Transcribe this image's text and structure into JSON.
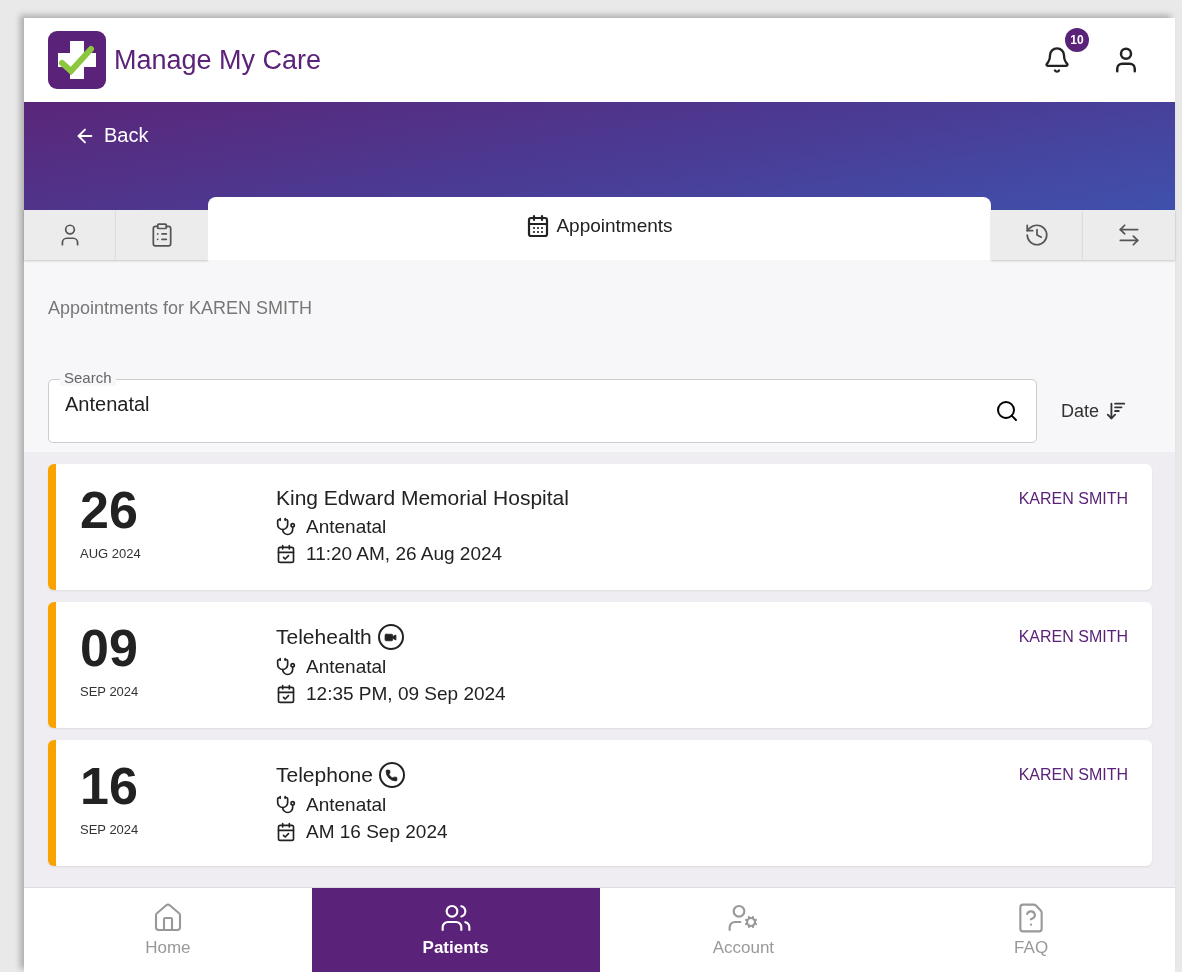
{
  "app": {
    "title": "Manage My Care",
    "notification_count": "10"
  },
  "back": {
    "label": "Back"
  },
  "tabs": [
    {
      "kind": "profile",
      "selected": false
    },
    {
      "kind": "checklist",
      "selected": false
    },
    {
      "kind": "calendar",
      "label": "Appointments",
      "selected": true
    },
    {
      "kind": "history",
      "selected": false
    },
    {
      "kind": "transfer",
      "selected": false
    }
  ],
  "heading": "Appointments for KAREN SMITH",
  "search": {
    "label": "Search",
    "value": "Antenatal"
  },
  "sort": {
    "label": "Date"
  },
  "appointments": [
    {
      "day": "26",
      "month": "AUG 2024",
      "location": "King Edward Memorial Hospital",
      "kind": "venue",
      "service": "Antenatal",
      "when": "11:20 AM, 26 Aug 2024",
      "patient": "KAREN SMITH"
    },
    {
      "day": "09",
      "month": "SEP 2024",
      "location": "Telehealth",
      "kind": "video",
      "service": "Antenatal",
      "when": "12:35 PM, 09 Sep 2024",
      "patient": "KAREN SMITH"
    },
    {
      "day": "16",
      "month": "SEP 2024",
      "location": "Telephone",
      "kind": "phone",
      "service": "Antenatal",
      "when": "AM 16 Sep 2024",
      "patient": "KAREN SMITH"
    }
  ],
  "nav": [
    {
      "kind": "home",
      "label": "Home",
      "selected": false
    },
    {
      "kind": "patients",
      "label": "Patients",
      "selected": true
    },
    {
      "kind": "account",
      "label": "Account",
      "selected": false
    },
    {
      "kind": "faq",
      "label": "FAQ",
      "selected": false
    }
  ]
}
